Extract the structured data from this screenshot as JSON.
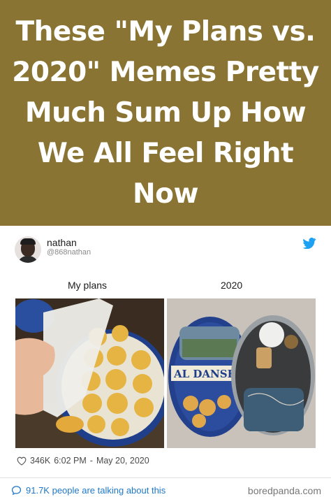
{
  "banner": {
    "title": "These \"My Plans vs. 2020\" Memes Pretty Much Sum Up How We All Feel Right Now",
    "background": "#8a7433"
  },
  "tweet": {
    "user_name": "nathan",
    "user_handle": "@868nathan",
    "label_left": "My plans",
    "label_right": "2020",
    "likes": "346K",
    "time": "6:02 PM",
    "separator": "-",
    "date": "May 20, 2020",
    "icons": [
      "twitter-bird-icon",
      "heart-icon",
      "comment-icon"
    ]
  },
  "footer": {
    "talking": "91.7K people are talking about this",
    "brand": "boredpanda.com"
  },
  "colors": {
    "twitter_blue": "#1da1f2",
    "link_blue": "#1e78c8"
  }
}
